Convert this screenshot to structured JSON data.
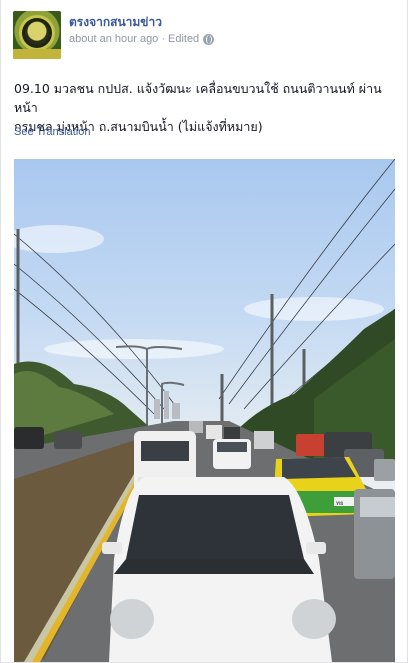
{
  "post": {
    "page_name": "ตรงจากสนามข่าว",
    "time": "about an hour ago",
    "separator": "·",
    "edited": "Edited",
    "privacy_icon": "globe-icon",
    "text_line1": "09.10 มวลชน กปปส. แจ้งวัฒนะ เคลื่อนขบวนใช้ ถนนติวานนท์ ผ่านหน้า",
    "text_line2": "กรมชล มุ่งหน้า ถ.สนามบินน้ำ (ไม่แจ้งที่หมาย)",
    "see_translation": "See Translation"
  },
  "photo": {
    "subject": "traffic-jam-road-photo",
    "taxi_plate": "ทย"
  },
  "colors": {
    "link": "#3b5998",
    "meta_gray": "#9197a3",
    "text": "#141823",
    "taxi_yellow": "#e9d21a",
    "taxi_green": "#3e9e3a"
  }
}
